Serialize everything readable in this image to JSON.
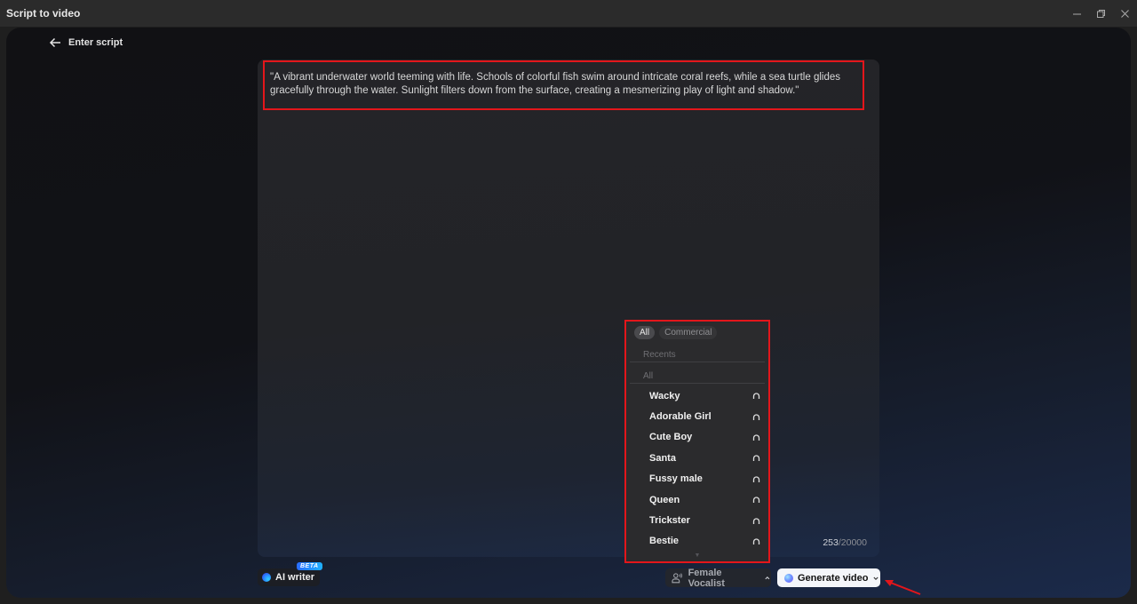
{
  "window": {
    "title": "Script to video",
    "controls": [
      "minimize",
      "restore",
      "close"
    ]
  },
  "header": {
    "back_label": "Enter script"
  },
  "editor": {
    "script_text": "\"A vibrant underwater world teeming with life. Schools of colorful fish swim around intricate coral reefs, while a sea turtle glides gracefully through the water. Sunlight filters down from the surface, creating a mesmerizing play of light and shadow.\"",
    "char_count": "253",
    "char_limit": "/20000"
  },
  "voice_dropdown": {
    "filters": [
      {
        "label": "All",
        "active": true
      },
      {
        "label": "Commercial",
        "active": false
      }
    ],
    "sections": {
      "recents": "Recents",
      "all": "All"
    },
    "voices": [
      {
        "name": "Wacky",
        "icon": "headphones-icon"
      },
      {
        "name": "Adorable Girl",
        "icon": "headphones-icon"
      },
      {
        "name": "Cute Boy",
        "icon": "headphones-icon"
      },
      {
        "name": "Santa",
        "icon": "headphones-icon"
      },
      {
        "name": "Fussy male",
        "icon": "headphones-icon"
      },
      {
        "name": "Queen",
        "icon": "headphones-icon"
      },
      {
        "name": "Trickster",
        "icon": "headphones-icon"
      },
      {
        "name": "Bestie",
        "icon": "headphones-icon"
      }
    ]
  },
  "footer": {
    "ai_writer_label": "AI writer",
    "ai_writer_badge": "BETA",
    "voice_selected": "Female Vocalist",
    "generate_label": "Generate video"
  },
  "colors": {
    "highlight_red": "#e3161b",
    "beta_blue": "#2a6cff",
    "generate_bg": "#f4f6fa"
  }
}
